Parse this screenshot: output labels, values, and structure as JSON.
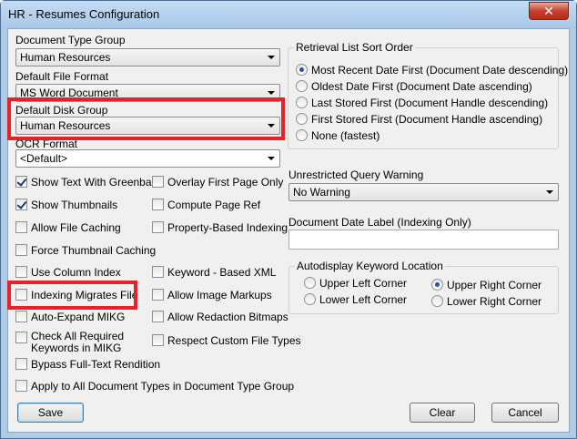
{
  "window": {
    "title": "HR - Resumes Configuration",
    "close_glyph": "✕"
  },
  "left": {
    "document_type_group": {
      "label": "Document Type Group",
      "value": "Human Resources"
    },
    "default_file_format": {
      "label": "Default File Format",
      "value": "MS Word Document"
    },
    "default_disk_group": {
      "label": "Default Disk Group",
      "value": "Human Resources"
    },
    "ocr_format": {
      "label": "OCR Format",
      "value": "<Default>"
    }
  },
  "checkboxes": {
    "show_text_greenbar": {
      "label": "Show Text With Greenbar",
      "checked": true
    },
    "show_thumbnails": {
      "label": "Show Thumbnails",
      "checked": true
    },
    "allow_file_caching": {
      "label": "Allow File Caching",
      "checked": false
    },
    "force_thumbnail_caching": {
      "label": "Force Thumbnail Caching",
      "checked": false
    },
    "use_column_index": {
      "label": "Use Column Index",
      "checked": false
    },
    "indexing_migrates_file": {
      "label": "Indexing Migrates File",
      "checked": false
    },
    "auto_expand_mikg": {
      "label": "Auto-Expand MIKG",
      "checked": false
    },
    "check_all_required_1": {
      "label": "Check All Required",
      "checked": false
    },
    "check_all_required_2": {
      "label": "Keywords in MIKG"
    },
    "bypass_full_text": {
      "label": "Bypass Full-Text Rendition",
      "checked": false
    },
    "overlay_first_page": {
      "label": "Overlay First Page Only",
      "checked": false
    },
    "compute_page_ref": {
      "label": "Compute Page Ref",
      "checked": false
    },
    "property_based_indexing": {
      "label": "Property-Based Indexing",
      "checked": false
    },
    "keyword_based_xml": {
      "label": "Keyword - Based XML",
      "checked": false
    },
    "allow_image_markups": {
      "label": "Allow Image Markups",
      "checked": false
    },
    "allow_redaction_bitmaps": {
      "label": "Allow Redaction Bitmaps",
      "checked": false
    },
    "respect_custom_file_types": {
      "label": "Respect Custom File Types",
      "checked": false
    },
    "apply_to_all": {
      "label": "Apply to All Document Types in Document Type Group",
      "checked": false
    }
  },
  "sort_order": {
    "legend": "Retrieval List Sort Order",
    "options": [
      {
        "label": "Most Recent Date First (Document Date descending)",
        "selected": true
      },
      {
        "label": "Oldest Date First (Document Date ascending)",
        "selected": false
      },
      {
        "label": "Last Stored First (Document Handle descending)",
        "selected": false
      },
      {
        "label": "First Stored First (Document Handle ascending)",
        "selected": false
      },
      {
        "label": "None (fastest)",
        "selected": false
      }
    ]
  },
  "unrestricted_query": {
    "label": "Unrestricted Query Warning",
    "value": "No Warning"
  },
  "document_date_label": {
    "label": "Document Date Label (Indexing Only)",
    "value": ""
  },
  "autodisplay": {
    "legend": "Autodisplay Keyword Location",
    "upper_left": "Upper Left Corner",
    "lower_left": "Lower Left Corner",
    "upper_right": "Upper Right Corner",
    "lower_right": "Lower Right Corner",
    "selected": "upper_right"
  },
  "buttons": {
    "save": "Save",
    "clear": "Clear",
    "cancel": "Cancel"
  },
  "colors": {
    "highlight": "#e8202a",
    "titlebar": "#aecbe8"
  }
}
